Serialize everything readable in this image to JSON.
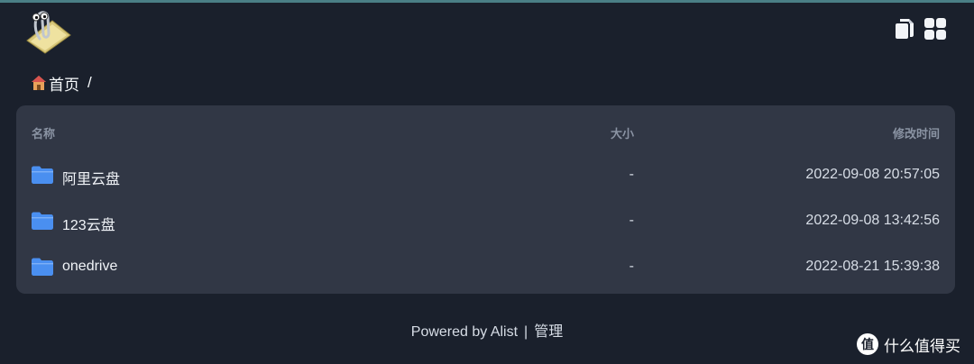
{
  "header": {
    "logo_name": "paperclip-logo",
    "icons": [
      "copy-icon",
      "grid-view-icon"
    ]
  },
  "breadcrumb": {
    "home_label": "首页",
    "separator": "/"
  },
  "table": {
    "columns": {
      "name": "名称",
      "size": "大小",
      "modified": "修改时间"
    },
    "rows": [
      {
        "name": "阿里云盘",
        "size": "-",
        "modified": "2022-09-08 20:57:05",
        "icon": "folder-icon"
      },
      {
        "name": "123云盘",
        "size": "-",
        "modified": "2022-09-08 13:42:56",
        "icon": "folder-icon"
      },
      {
        "name": "onedrive",
        "size": "-",
        "modified": "2022-08-21 15:39:38",
        "icon": "folder-icon"
      }
    ]
  },
  "footer": {
    "powered_by": "Powered by Alist",
    "separator": "|",
    "admin": "管理"
  },
  "watermark": {
    "text": "什么值得买"
  },
  "colors": {
    "background": "#1a202c",
    "card": "#313745",
    "folder": "#4a8ff0",
    "top_line": "#4a7f86"
  }
}
